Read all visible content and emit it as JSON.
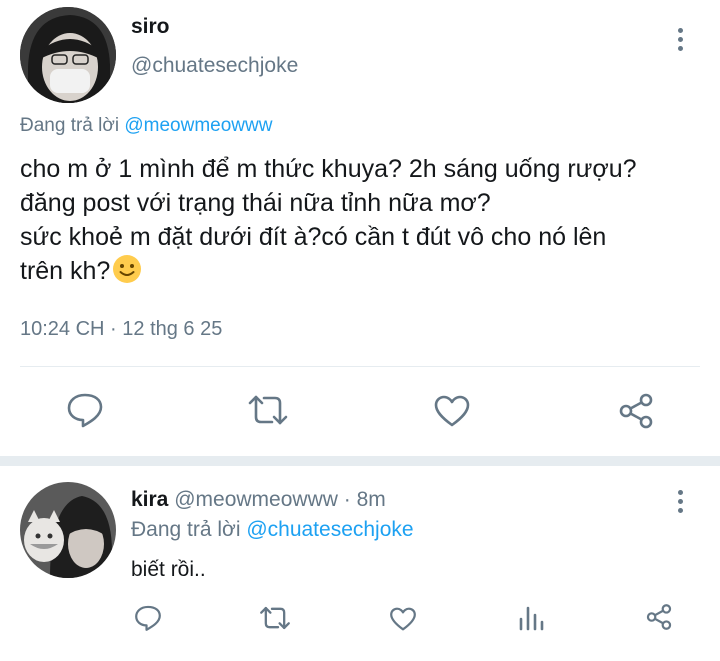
{
  "main_tweet": {
    "name": "siro",
    "handle": "@chuatesechjoke",
    "reply_prefix": "Đang trả lời",
    "reply_to": "@meowmeowww",
    "lines": [
      "cho m ở 1 mình để m thức khuya? 2h sáng uống rượu?",
      "đăng post với trạng thái nữa tỉnh nữa mơ?",
      "sức khoẻ m đặt dưới đít à?có cần t đút vô cho nó lên",
      "trên kh?"
    ],
    "emoji": "🙂",
    "timestamp": "10:24 CH · 12 thg 6 25"
  },
  "reply_tweet": {
    "name": "kira",
    "handle_time": "@meowmeowww · 8m",
    "reply_prefix": "Đang trả lời",
    "reply_to": "@chuatesechjoke",
    "text": "biết rồi.."
  },
  "icons": {
    "reply": "comment-icon",
    "retweet": "retweet-icon",
    "like": "heart-icon",
    "share": "share-icon",
    "stats": "analytics-icon",
    "more": "more-vertical-icon"
  },
  "colors": {
    "accent": "#1da1f2",
    "secondary_text": "#657786",
    "divider": "#e6ecf0"
  }
}
